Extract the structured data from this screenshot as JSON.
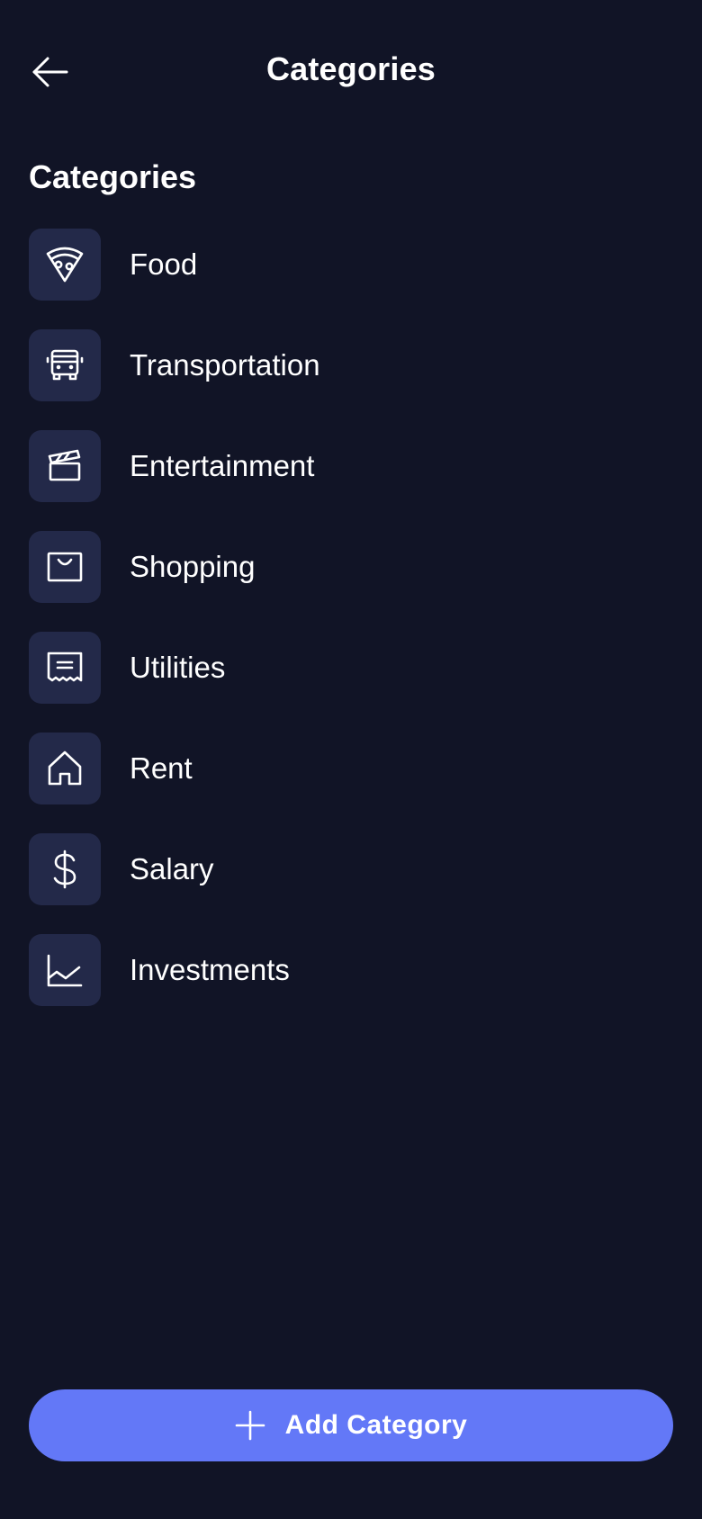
{
  "header": {
    "title": "Categories",
    "back_icon": "arrow-left-icon"
  },
  "section": {
    "title": "Categories"
  },
  "categories": [
    {
      "label": "Food",
      "icon": "pizza-icon"
    },
    {
      "label": "Transportation",
      "icon": "bus-icon"
    },
    {
      "label": "Entertainment",
      "icon": "clapperboard-icon"
    },
    {
      "label": "Shopping",
      "icon": "shopping-bag-icon"
    },
    {
      "label": "Utilities",
      "icon": "receipt-icon"
    },
    {
      "label": "Rent",
      "icon": "home-icon"
    },
    {
      "label": "Salary",
      "icon": "dollar-sign-icon"
    },
    {
      "label": "Investments",
      "icon": "line-chart-icon"
    }
  ],
  "add_button": {
    "label": "Add Category",
    "icon": "plus-icon"
  },
  "colors": {
    "background": "#111426",
    "icon_tile": "#232949",
    "accent": "#6378f7",
    "text": "#ffffff"
  }
}
